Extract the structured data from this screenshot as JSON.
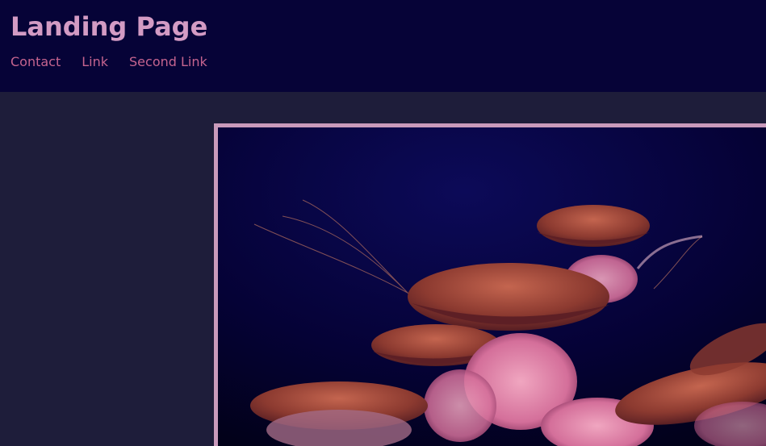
{
  "header": {
    "title": "Landing Page",
    "nav": [
      {
        "label": "Contact"
      },
      {
        "label": "Link"
      },
      {
        "label": "Second Link"
      }
    ]
  },
  "colors": {
    "header_bg": "#060337",
    "page_bg": "#1e1d3a",
    "title": "#d39bc4",
    "link": "#c5648f",
    "frame_border": "#c99abb"
  },
  "hero": {
    "subject": "jellyfish-photo"
  }
}
